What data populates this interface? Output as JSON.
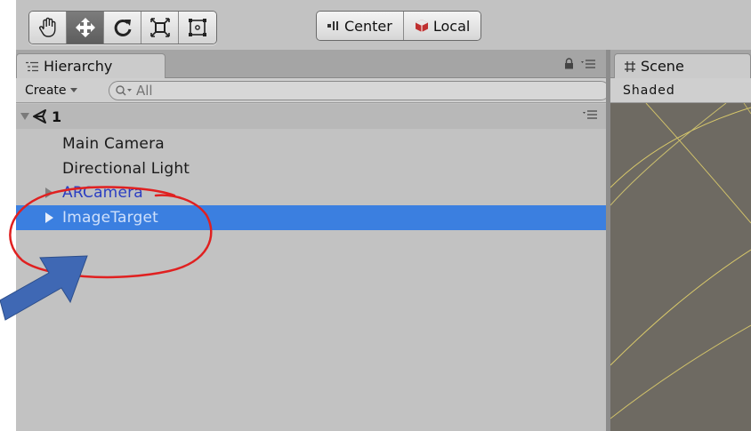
{
  "toolbar": {
    "tools": [
      {
        "name": "hand-tool",
        "icon": "hand-icon",
        "active": false
      },
      {
        "name": "move-tool",
        "icon": "move-arrows-icon",
        "active": true
      },
      {
        "name": "rotate-tool",
        "icon": "rotate-icon",
        "active": false
      },
      {
        "name": "scale-tool",
        "icon": "scale-icon",
        "active": false
      },
      {
        "name": "rect-tool",
        "icon": "rect-transform-icon",
        "active": false
      }
    ],
    "pivot_label": "Center",
    "space_label": "Local"
  },
  "hierarchy": {
    "tab_label": "Hierarchy",
    "create_label": "Create",
    "search_placeholder": "All",
    "scene_name": "1",
    "items": [
      {
        "label": "Main Camera",
        "has_children": false,
        "selected": false
      },
      {
        "label": "Directional Light",
        "has_children": false,
        "selected": false
      },
      {
        "label": "ARCamera",
        "has_children": true,
        "selected": false,
        "prefab": true
      },
      {
        "label": "ImageTarget",
        "has_children": true,
        "selected": true,
        "prefab": true
      }
    ]
  },
  "scene": {
    "tab_label": "Scene",
    "shading_mode": "Shaded"
  },
  "colors": {
    "selection": "#3b7fe0",
    "annotation_circle": "#e02020",
    "annotation_arrow": "#3f68b4"
  }
}
